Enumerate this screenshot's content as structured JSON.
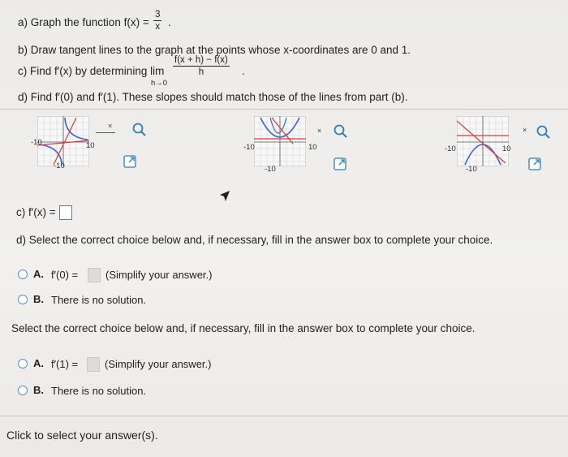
{
  "question": {
    "part_a_prefix": "a) Graph the function f(x) =",
    "part_a_num": "3",
    "part_a_den": "x",
    "part_a_suffix": ".",
    "part_b": "b) Draw tangent lines to the graph at the points whose x-coordinates are 0 and 1.",
    "part_c_prefix": "c) Find f′(x) by determining  lim",
    "part_c_num": "f(x + h) − f(x)",
    "part_c_den": "h",
    "part_c_suffix": ".",
    "part_c_sub": "h→0",
    "part_d": "d) Find f′(0) and f′(1). These slopes should match those of the lines from part (b)."
  },
  "graphs": [
    {
      "left_tick": "-10",
      "right_tick": "10",
      "bottom_tick": "-10",
      "zoom_x": "×"
    },
    {
      "left_tick": "-10",
      "right_tick": "10",
      "bottom_tick": "-10",
      "zoom_x": "×"
    },
    {
      "left_tick": "-10",
      "right_tick": "10",
      "bottom_tick": "-10",
      "zoom_x": "×"
    }
  ],
  "answers": {
    "c_label": "c) f′(x) =",
    "d_prompt": "d) Select the correct choice below and, if necessary, fill in the answer box to complete your choice.",
    "d1_a_letter": "A.",
    "d1_a_label": "f′(0) =",
    "d1_a_hint": "(Simplify your answer.)",
    "d1_b_letter": "B.",
    "d1_b_text": "There is no solution.",
    "d2_prompt": "Select the correct choice below and, if necessary, fill in the answer box to complete your choice.",
    "d2_a_letter": "A.",
    "d2_a_label": "f′(1) =",
    "d2_a_hint": "(Simplify your answer.)",
    "d2_b_letter": "B.",
    "d2_b_text": "There is no solution."
  },
  "footer": {
    "status": "Click to select your answer(s)."
  },
  "colors": {
    "radio": "#5a8fc4",
    "graph_curve": "#3b5fd6",
    "graph_red": "#d93a3a"
  }
}
